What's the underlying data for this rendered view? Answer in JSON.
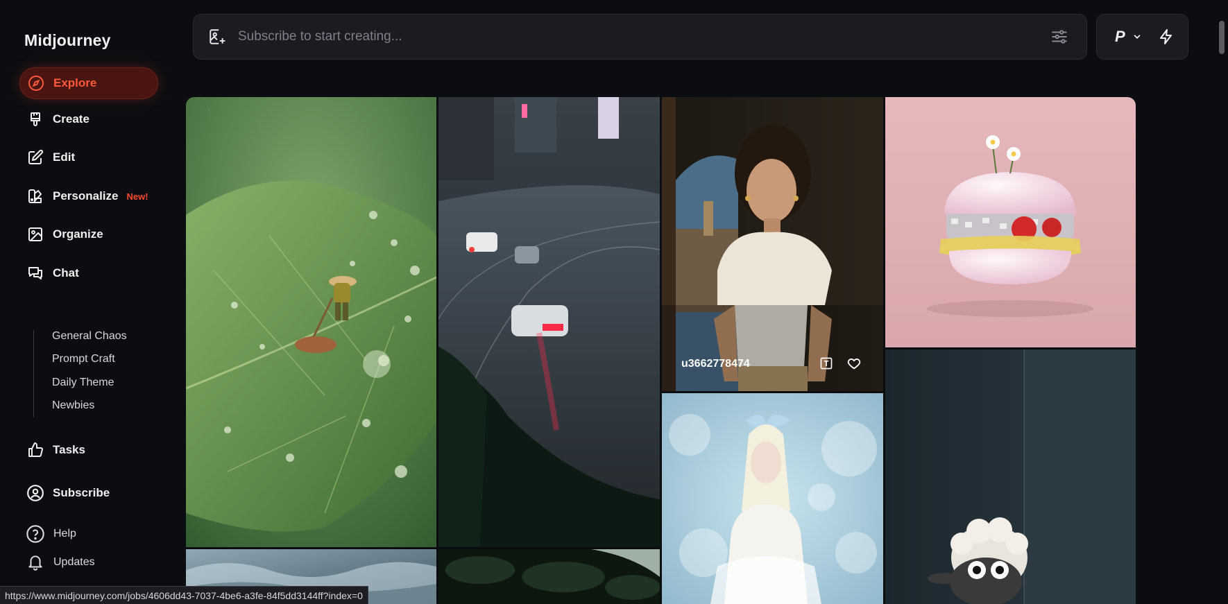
{
  "brand": {
    "logo": "Midjourney",
    "accent": "#ff5a3c"
  },
  "sidebar": {
    "items": [
      {
        "label": "Explore",
        "icon": "compass-icon",
        "active": true
      },
      {
        "label": "Create",
        "icon": "brush-icon"
      },
      {
        "label": "Edit",
        "icon": "pencil-square-icon"
      },
      {
        "label": "Personalize",
        "icon": "palette-icon",
        "badge": "New!"
      },
      {
        "label": "Organize",
        "icon": "image-icon"
      },
      {
        "label": "Chat",
        "icon": "chat-bubbles-icon"
      }
    ],
    "chat_channels": [
      "General Chaos",
      "Prompt Craft",
      "Daily Theme",
      "Newbies"
    ],
    "lower_items": [
      {
        "label": "Tasks",
        "icon": "thumbs-up-icon"
      },
      {
        "label": "Subscribe",
        "icon": "user-circle-icon"
      }
    ],
    "footer_items": [
      {
        "label": "Help",
        "icon": "help-circle-icon"
      },
      {
        "label": "Updates",
        "icon": "bell-icon"
      }
    ]
  },
  "search": {
    "placeholder": "Subscribe to start creating..."
  },
  "mode": {
    "label": "P"
  },
  "gallery": {
    "hovered_user": "u3662778474",
    "tiles": [
      {
        "subject": "leaf-with-farmer"
      },
      {
        "subject": "rainy-city-cars"
      },
      {
        "subject": "woman-white-tee"
      },
      {
        "subject": "pink-disco-burger"
      },
      {
        "subject": "blue-girl-bubbles"
      },
      {
        "subject": "sheep-peeking"
      },
      {
        "subject": "water-waves"
      },
      {
        "subject": "dark-foliage"
      }
    ]
  },
  "status_bar": {
    "url": "https://www.midjourney.com/jobs/4606dd43-7037-4be6-a3fe-84f5dd3144ff?index=0"
  }
}
